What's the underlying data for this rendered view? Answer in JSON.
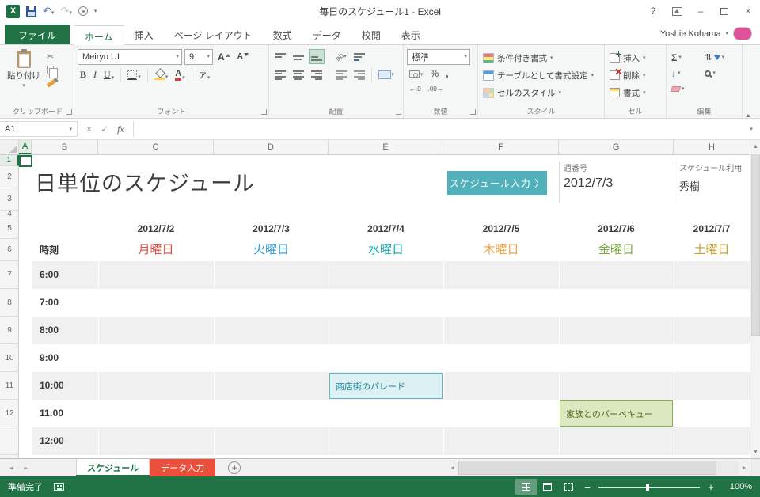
{
  "window": {
    "title": "毎日のスケジュール1 - Excel"
  },
  "titlebar": {
    "user_name": "Yoshie Kohama"
  },
  "colors": {
    "excel_green": "#217346",
    "band_gray": "#F0F0F0"
  },
  "icons": {
    "excel_logo": "X",
    "dropdown": "▾",
    "undo": "↶",
    "redo": "↷",
    "help": "?",
    "minimize": "–",
    "close": "×",
    "scissors": "✂",
    "bold": "B",
    "italic": "I",
    "underline": "U",
    "letter_A": "A",
    "phonetic": "ア",
    "orientation": "ab",
    "percent": "%",
    "comma": ",",
    "inc_decimal": "←.0",
    "dec_decimal": ".00→",
    "autosum": "Σ",
    "sort": "⇅",
    "fill_down": "↓",
    "nav_left": "◂",
    "nav_right": "▸",
    "scroll_up": "▲",
    "scroll_down": "▼",
    "scroll_left": "◄",
    "scroll_right": "►",
    "add_sheet": "+"
  },
  "ribbon_tabs": {
    "file": "ファイル",
    "items": [
      "ホーム",
      "挿入",
      "ページ レイアウト",
      "数式",
      "データ",
      "校閲",
      "表示"
    ],
    "active": "ホーム"
  },
  "ribbon": {
    "clipboard": {
      "group_label": "クリップボード",
      "paste_label": "貼り付け"
    },
    "font": {
      "group_label": "フォント",
      "family": "Meiryo UI",
      "size": "9"
    },
    "alignment": {
      "group_label": "配置"
    },
    "number": {
      "group_label": "数値",
      "format": "標準"
    },
    "styles": {
      "group_label": "スタイル",
      "conditional": "条件付き書式",
      "format_table": "テーブルとして書式設定",
      "cell_styles": "セルのスタイル"
    },
    "cells": {
      "group_label": "セル",
      "insert": "挿入",
      "delete": "削除",
      "format": "書式"
    },
    "editing": {
      "group_label": "編集"
    }
  },
  "formula_bar": {
    "name_box": "A1",
    "cancel": "×",
    "enter": "✓",
    "fx": "fx",
    "value": ""
  },
  "sheet": {
    "col_headers": [
      "A",
      "B",
      "C",
      "D",
      "E",
      "F",
      "G",
      "H"
    ],
    "row_numbers": [
      "1",
      "2",
      "3",
      "4",
      "5",
      "6",
      "7",
      "8",
      "9",
      "10",
      "11",
      "12"
    ],
    "title": "日単位のスケジュール",
    "input_button": "スケジュール入力 〉",
    "input_button_color": "#52B0BA",
    "week_label": "週番号",
    "week_value": "2012/7/3",
    "owner_label": "スケジュール利用",
    "owner_value": "秀樹",
    "time_header": "時刻",
    "days": [
      {
        "date": "2012/7/2",
        "name": "月曜日",
        "color": "#DF4B3B"
      },
      {
        "date": "2012/7/3",
        "name": "火曜日",
        "color": "#2E9BD6"
      },
      {
        "date": "2012/7/4",
        "name": "水曜日",
        "color": "#1CA8A8"
      },
      {
        "date": "2012/7/5",
        "name": "木曜日",
        "color": "#ECA23D"
      },
      {
        "date": "2012/7/6",
        "name": "金曜日",
        "color": "#7CA842"
      },
      {
        "date": "2012/7/7",
        "name": "土曜日",
        "color": "#C2A136"
      }
    ],
    "times": [
      "6:00",
      "7:00",
      "8:00",
      "9:00",
      "10:00",
      "11:00",
      "12:00"
    ],
    "events": [
      {
        "label": "商店街のパレード",
        "date": "2012/7/4",
        "time": "10:00",
        "fill": "#DCF1F4",
        "border": "#5FB6C4",
        "text": "#1F8795"
      },
      {
        "label": "家族とのバーベキュー",
        "date": "2012/7/6",
        "time": "11:00",
        "fill": "#DCE9C0",
        "border": "#88B04B",
        "text": "#4F661C"
      }
    ]
  },
  "sheet_tabs": {
    "tabs": [
      {
        "label": "スケジュール",
        "active": true
      },
      {
        "label": "データ入力",
        "active": false,
        "color": "#E8503C"
      }
    ]
  },
  "status_bar": {
    "status": "準備完了",
    "zoom_minus": "−",
    "zoom_plus": "+",
    "zoom": "100%"
  }
}
